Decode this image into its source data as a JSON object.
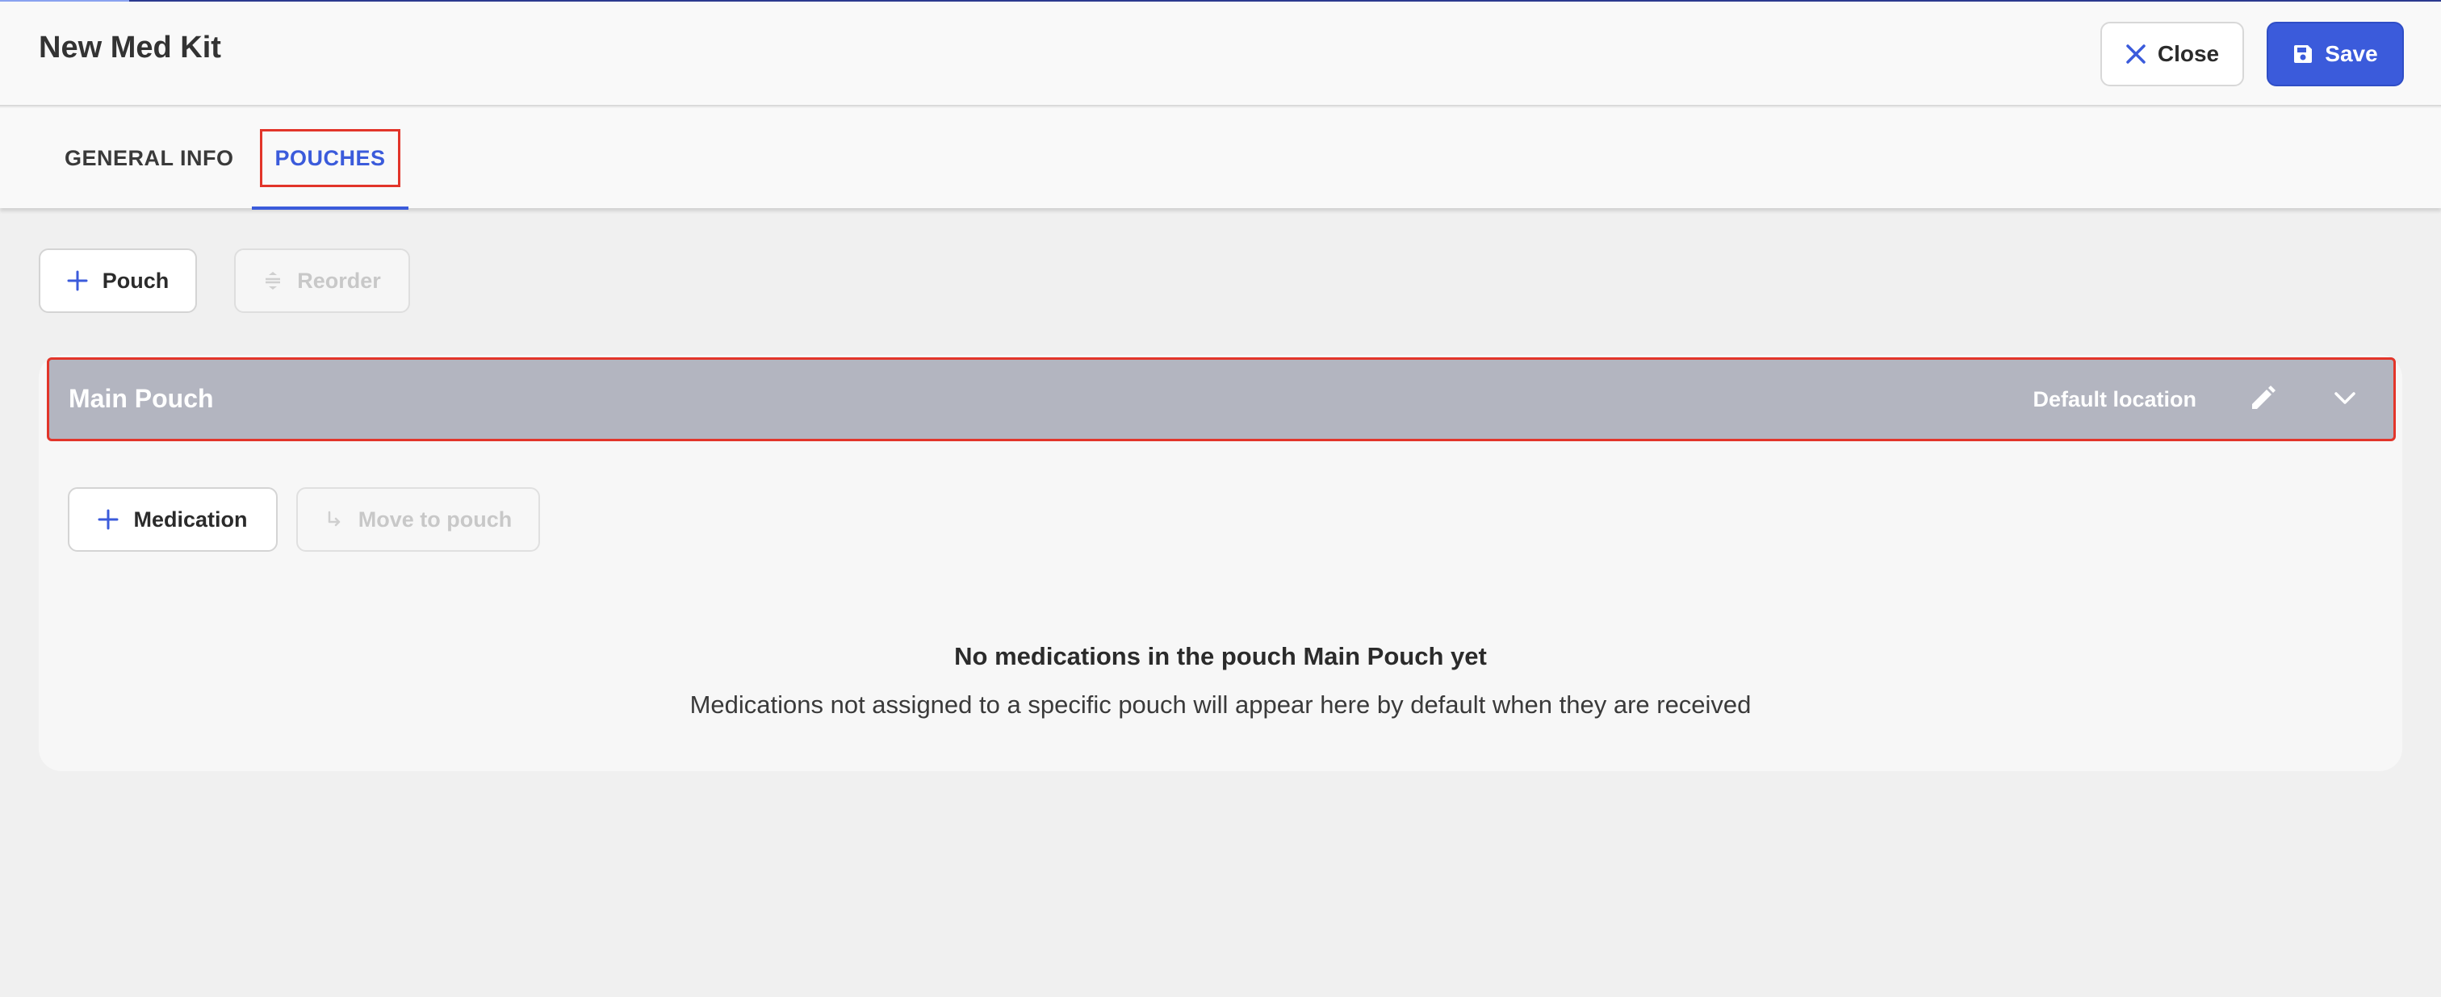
{
  "header": {
    "title": "New Med Kit",
    "close_label": "Close",
    "save_label": "Save",
    "icons": {
      "close": "close-icon",
      "save": "save-icon"
    },
    "colors": {
      "primary": "#3b5bdb"
    }
  },
  "tabs": [
    {
      "label": "GENERAL INFO",
      "active": false
    },
    {
      "label": "POUCHES",
      "active": true
    }
  ],
  "toolbar": {
    "add_pouch_label": "Pouch",
    "reorder_label": "Reorder",
    "reorder_disabled": true
  },
  "pouch": {
    "name": "Main Pouch",
    "location": "Default location",
    "add_medication_label": "Medication",
    "move_to_pouch_label": "Move to pouch",
    "move_disabled": true,
    "empty_title": "No medications in the pouch Main Pouch yet",
    "empty_description": "Medications not assigned to a specific pouch will appear here by default when they are received"
  },
  "highlight_color": "#e2352a"
}
